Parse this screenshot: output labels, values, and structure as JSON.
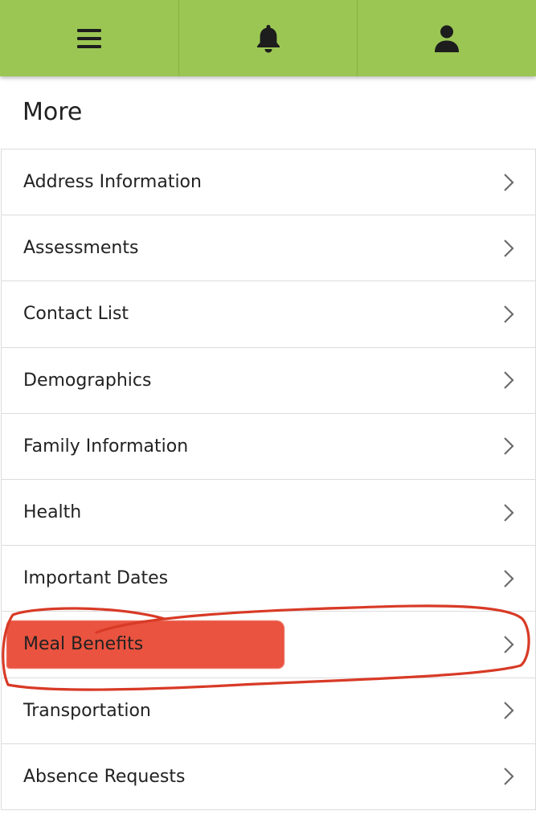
{
  "header": {
    "menu_icon": "hamburger-menu-icon",
    "notifications_icon": "bell-icon",
    "profile_icon": "user-icon",
    "bar_color": "#9bc653"
  },
  "page": {
    "title": "More"
  },
  "menu": {
    "items": [
      {
        "label": "Address Information"
      },
      {
        "label": "Assessments"
      },
      {
        "label": "Contact List"
      },
      {
        "label": "Demographics"
      },
      {
        "label": "Family Information"
      },
      {
        "label": "Health"
      },
      {
        "label": "Important Dates"
      },
      {
        "label": "Meal Benefits"
      },
      {
        "label": "Transportation"
      },
      {
        "label": "Absence Requests"
      }
    ]
  },
  "annotation": {
    "highlighted_item": "Meal Benefits",
    "color": "#e8452f"
  }
}
